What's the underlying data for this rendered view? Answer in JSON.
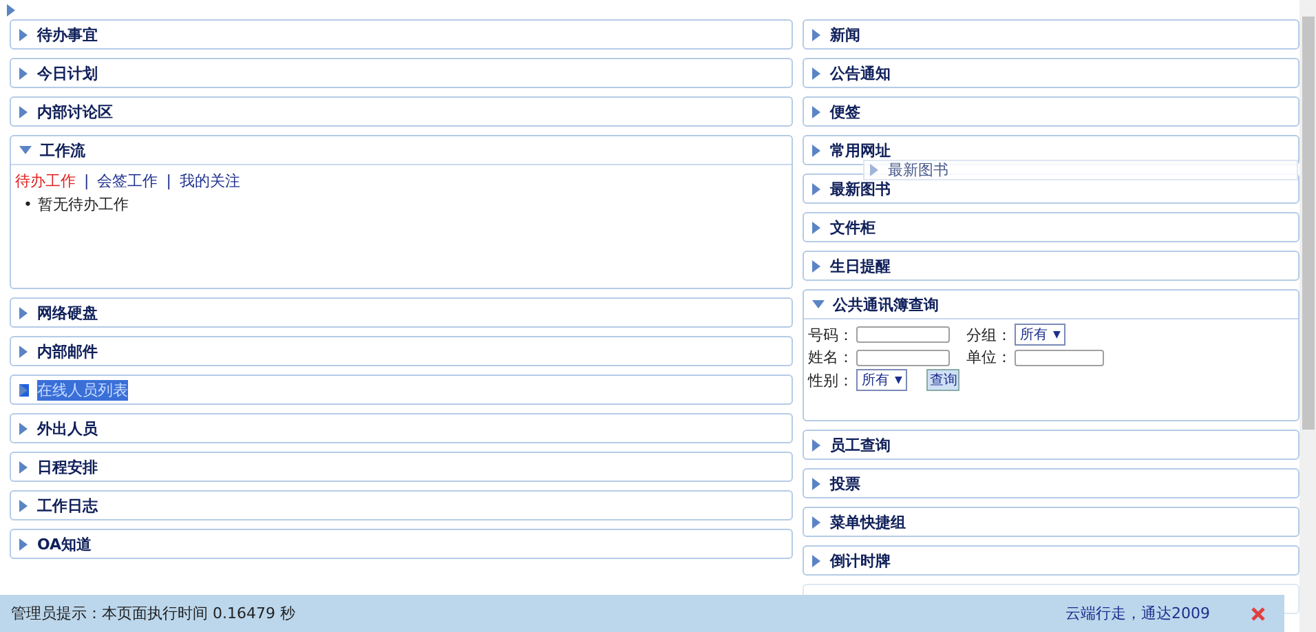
{
  "left_panels": [
    {
      "title": "待办事宜",
      "expanded": false,
      "text_selected": false
    },
    {
      "title": "今日计划",
      "expanded": false,
      "text_selected": false
    },
    {
      "title": "内部讨论区",
      "expanded": false,
      "text_selected": false
    },
    {
      "title": "工作流",
      "expanded": true,
      "text_selected": false,
      "kind": "workflow",
      "tabs": [
        {
          "label": "待办工作",
          "selected": true
        },
        {
          "label": "会签工作",
          "selected": false
        },
        {
          "label": "我的关注",
          "selected": false
        }
      ],
      "tab_separator": "|",
      "bullet": "•",
      "items": [
        "暂无待办工作"
      ]
    },
    {
      "title": "网络硬盘",
      "expanded": false,
      "text_selected": false
    },
    {
      "title": "内部邮件",
      "expanded": false,
      "text_selected": false
    },
    {
      "title": "在线人员列表",
      "expanded": false,
      "text_selected": true
    },
    {
      "title": "外出人员",
      "expanded": false,
      "text_selected": false
    },
    {
      "title": "日程安排",
      "expanded": false,
      "text_selected": false
    },
    {
      "title": "工作日志",
      "expanded": false,
      "text_selected": false
    },
    {
      "title": "OA知道",
      "expanded": false,
      "text_selected": false
    }
  ],
  "right_panels": [
    {
      "title": "新闻",
      "expanded": false,
      "text_selected": false
    },
    {
      "title": "公告通知",
      "expanded": false,
      "text_selected": false
    },
    {
      "title": "便签",
      "expanded": false,
      "text_selected": false
    },
    {
      "title": "常用网址",
      "expanded": false,
      "text_selected": false
    },
    {
      "title": "最新图书",
      "expanded": false,
      "text_selected": false
    },
    {
      "title": "文件柜",
      "expanded": false,
      "text_selected": false
    },
    {
      "title": "生日提醒",
      "expanded": false,
      "text_selected": false
    },
    {
      "title": "公共通讯簿查询",
      "expanded": true,
      "text_selected": false,
      "kind": "contacts",
      "fields": [
        {
          "label": "号码：",
          "kind": "text"
        },
        {
          "label": "分组：",
          "kind": "select",
          "value": "所有"
        },
        {
          "label": "姓名：",
          "kind": "text"
        },
        {
          "label": "单位：",
          "kind": "text"
        },
        {
          "label": "性别：",
          "kind": "select",
          "value": "所有"
        }
      ],
      "select_arrow": "▼",
      "button": "查询"
    },
    {
      "title": "员工查询",
      "expanded": false,
      "text_selected": false
    },
    {
      "title": "投票",
      "expanded": false,
      "text_selected": false
    },
    {
      "title": "菜单快捷组",
      "expanded": false,
      "text_selected": false
    },
    {
      "title": "倒计时牌",
      "expanded": false,
      "text_selected": false
    }
  ],
  "dragged_panel": {
    "title": "最新图书"
  },
  "footer": {
    "hint": "管理员提示：本页面执行时间 0.16479 秒",
    "brand": "云端行走，通达2009"
  }
}
